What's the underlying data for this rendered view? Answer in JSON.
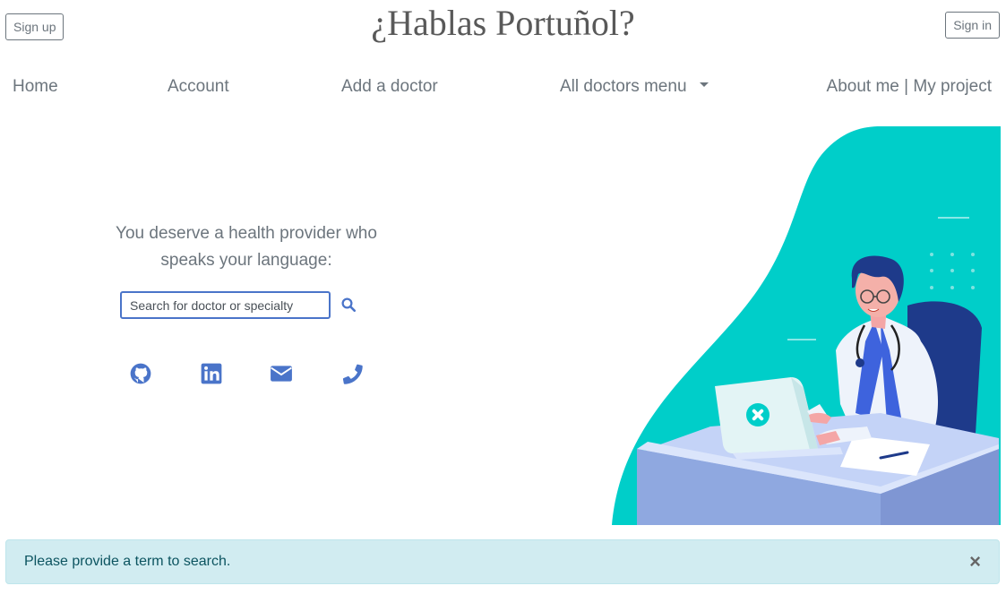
{
  "header": {
    "title": "¿Hablas Portuñol?",
    "signup_label": "Sign up",
    "signin_label": "Sign in"
  },
  "nav": {
    "home": "Home",
    "account": "Account",
    "add_doctor": "Add a doctor",
    "all_doctors": "All doctors menu",
    "about": "About me | My project"
  },
  "main": {
    "tagline_line1": "You deserve a health provider who",
    "tagline_line2": "speaks your language:",
    "search": {
      "placeholder": "Search for doctor or specialty",
      "value": ""
    },
    "social_icons": [
      "github-icon",
      "linkedin-icon",
      "email-icon",
      "phone-icon"
    ]
  },
  "alert": {
    "message": "Please provide a term to search.",
    "close": "×"
  },
  "colors": {
    "accent": "#4a74c9",
    "teal": "#00cec9",
    "alert_bg": "#d1ecf1",
    "alert_text": "#0c5460"
  }
}
